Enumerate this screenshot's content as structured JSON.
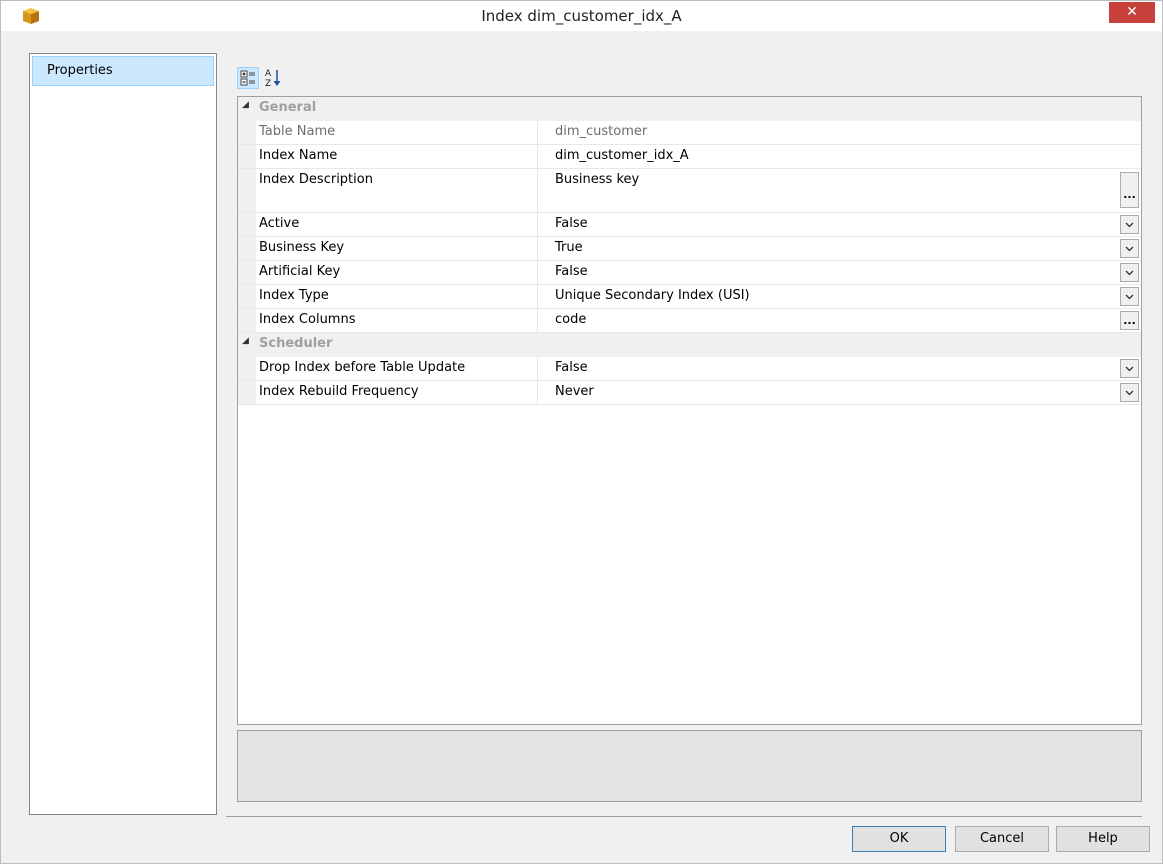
{
  "window": {
    "title": "Index dim_customer_idx_A",
    "close_glyph": "✕",
    "accent_close": "#c7403a"
  },
  "nav": {
    "items": [
      {
        "label": "Properties",
        "selected": true
      }
    ]
  },
  "toolbar": {
    "categorized_icon": "categorized-icon",
    "alphabetical_icon": "sort-alphabetical-icon"
  },
  "grid": {
    "categories": [
      {
        "label": "General",
        "expanded_glyph": "◢",
        "rows": [
          {
            "name": "Table Name",
            "value": "dim_customer",
            "readonly": true,
            "editor": "none"
          },
          {
            "name": "Index Name",
            "value": "dim_customer_idx_A",
            "editor": "none"
          },
          {
            "name": "Index Description",
            "value": "Business key",
            "editor": "ellipsis"
          },
          {
            "name": "Active",
            "value": "False",
            "editor": "dropdown"
          },
          {
            "name": "Business Key",
            "value": "True",
            "editor": "dropdown"
          },
          {
            "name": "Artificial Key",
            "value": "False",
            "editor": "dropdown"
          },
          {
            "name": "Index Type",
            "value": "Unique Secondary Index (USI)",
            "editor": "dropdown"
          },
          {
            "name": "Index Columns",
            "value": "code",
            "editor": "ellipsis"
          }
        ]
      },
      {
        "label": "Scheduler",
        "expanded_glyph": "◢",
        "rows": [
          {
            "name": "Drop Index before Table Update",
            "value": "False",
            "editor": "dropdown"
          },
          {
            "name": "Index Rebuild Frequency",
            "value": "Never",
            "editor": "dropdown"
          }
        ]
      }
    ],
    "ellipsis_label": "..."
  },
  "buttons": {
    "ok": "OK",
    "cancel": "Cancel",
    "help": "Help"
  }
}
